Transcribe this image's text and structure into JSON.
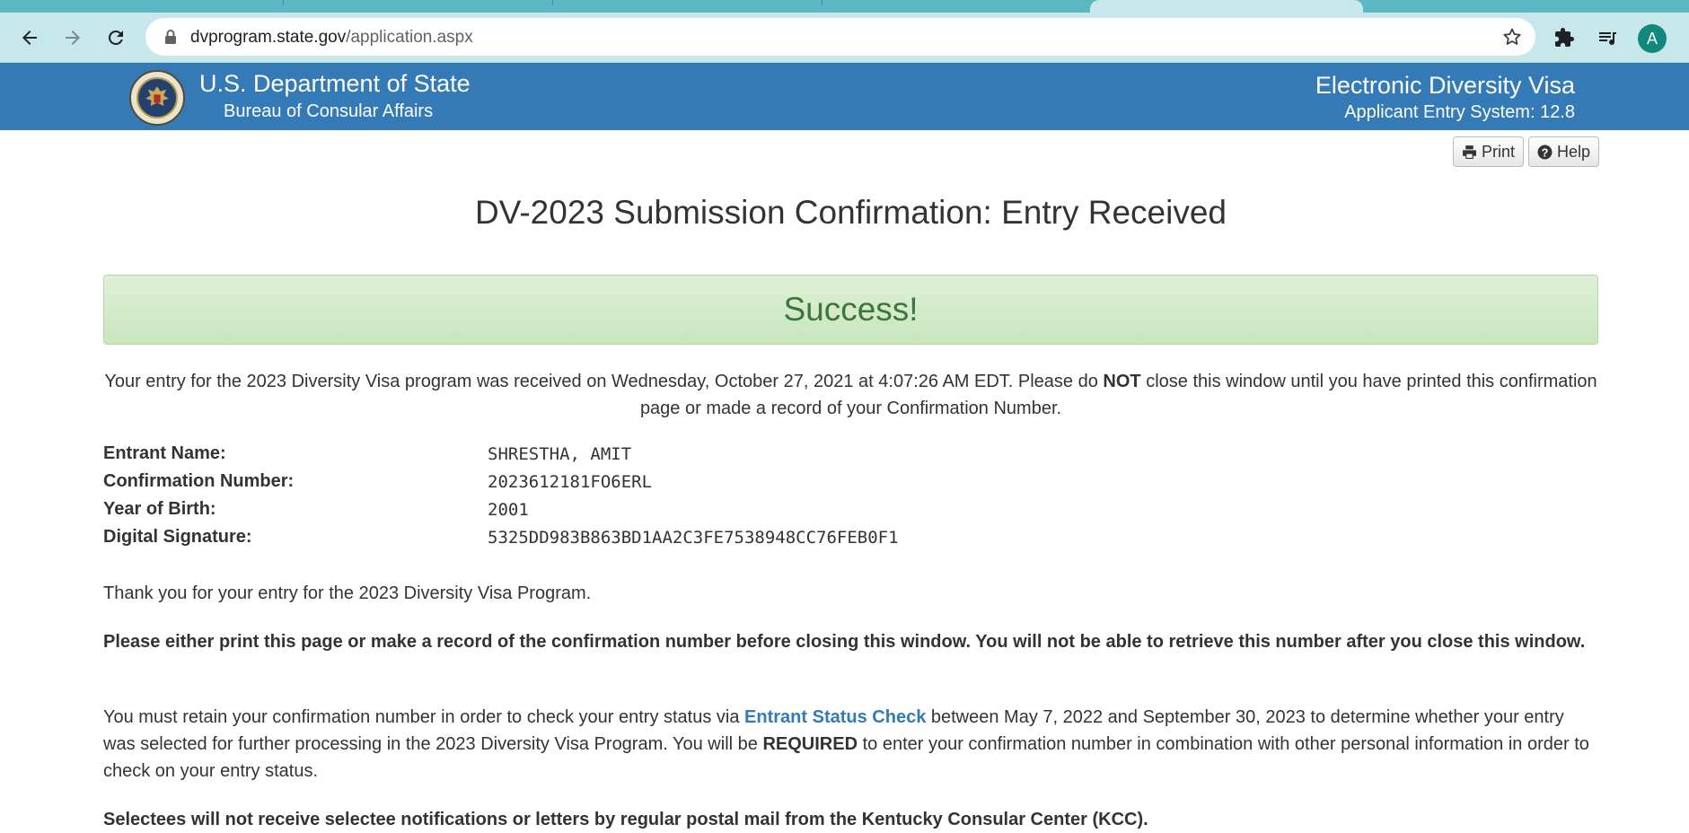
{
  "browser": {
    "url_domain": "dvprogram.state.gov",
    "url_path": "/application.aspx",
    "profile_initial": "A"
  },
  "header": {
    "department": "U.S. Department of State",
    "bureau": "Bureau of Consular Affairs",
    "system_title": "Electronic Diversity Visa",
    "system_version": "Applicant Entry System: 12.8"
  },
  "actions": {
    "print_label": "Print",
    "help_label": "Help"
  },
  "page": {
    "title": "DV-2023 Submission Confirmation: Entry Received",
    "success_message": "Success!",
    "received_prefix": "Your entry for the 2023 Diversity Visa program was received on Wednesday, October 27, 2021 at 4:07:26 AM EDT. Please do ",
    "received_emphasis": "NOT",
    "received_suffix": " close this window until you have printed this confirmation page or made a record of your Confirmation Number."
  },
  "entry": [
    {
      "label": "Entrant Name:",
      "value": "SHRESTHA, AMIT"
    },
    {
      "label": "Confirmation Number:",
      "value": "2023612181FO6ERL"
    },
    {
      "label": "Year of Birth:",
      "value": "2001"
    },
    {
      "label": "Digital Signature:",
      "value": "5325DD983B863BD1AA2C3FE7538948CC76FEB0F1"
    }
  ],
  "paragraphs": {
    "thank_you": "Thank you for your entry for the 2023 Diversity Visa Program.",
    "print_warning": "Please either print this page or make a record of the confirmation number before closing this window. You will not be able to retrieve this number after you close this window.",
    "retain_prefix": "You must retain your confirmation number in order to check your entry status via ",
    "retain_link": "Entrant Status Check",
    "retain_middle": " between May 7, 2022 and September 30, 2023 to determine whether your entry was selected for further processing in the 2023 Diversity Visa Program. You will be ",
    "retain_emphasis": "REQUIRED",
    "retain_suffix": " to enter your confirmation number in combination with other personal information in order to check on your entry status.",
    "selectees_notice": "Selectees will not receive selectee notifications or letters by regular postal mail from the Kentucky Consular Center (KCC)."
  },
  "colors": {
    "header_blue": "#337ab7",
    "success_green": "#3c763d",
    "link_blue": "#337ab7",
    "chrome_teal": "#5db7c0"
  }
}
